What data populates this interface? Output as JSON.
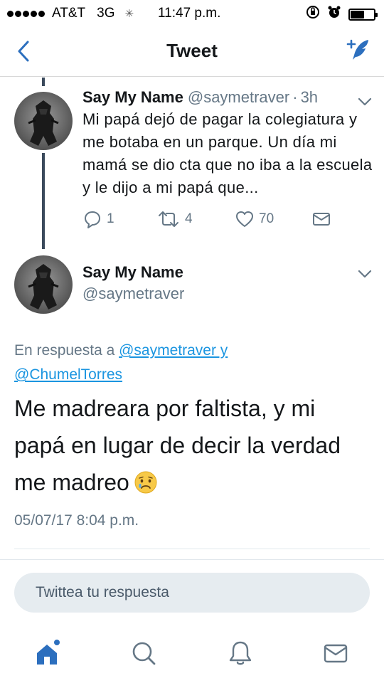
{
  "status_bar": {
    "carrier": "AT&T",
    "network": "3G",
    "time": "11:47 p.m.",
    "signal_bars": 5,
    "battery_level": 0.55
  },
  "nav": {
    "title": "Tweet",
    "back_icon": "chevron-left-icon",
    "compose_icon": "compose-tweet-icon"
  },
  "tweet1": {
    "name": "Say My Name",
    "handle": "@saymetraver",
    "separator": "·",
    "time": "3h",
    "text": "Mi papá dejó de pagar la colegiatura y me botaba en un parque. Un día mi mamá se dio cta que no iba a la escuela y le dijo a mi papá que...",
    "replies": "1",
    "retweets": "4",
    "likes": "70"
  },
  "tweet2": {
    "name": "Say My Name",
    "handle": "@saymetraver",
    "reply_prefix": "En respuesta a ",
    "mention1": "@saymetraver y",
    "mention2": "@ChumelTorres",
    "text": "Me madreara por faltista, y mi papá en lugar de decir la verdad me madreo",
    "emoji": "sad-face-emoji",
    "datetime": "05/07/17 8:04 p.m."
  },
  "reply_box": {
    "placeholder": "Twittea tu respuesta"
  },
  "tabbar": {
    "items": [
      "home-icon",
      "search-icon",
      "notifications-icon",
      "messages-icon"
    ]
  },
  "colors": {
    "accent": "#1da1f2",
    "nav_blue": "#2c6fbe",
    "muted": "#657786",
    "text": "#14171a"
  }
}
